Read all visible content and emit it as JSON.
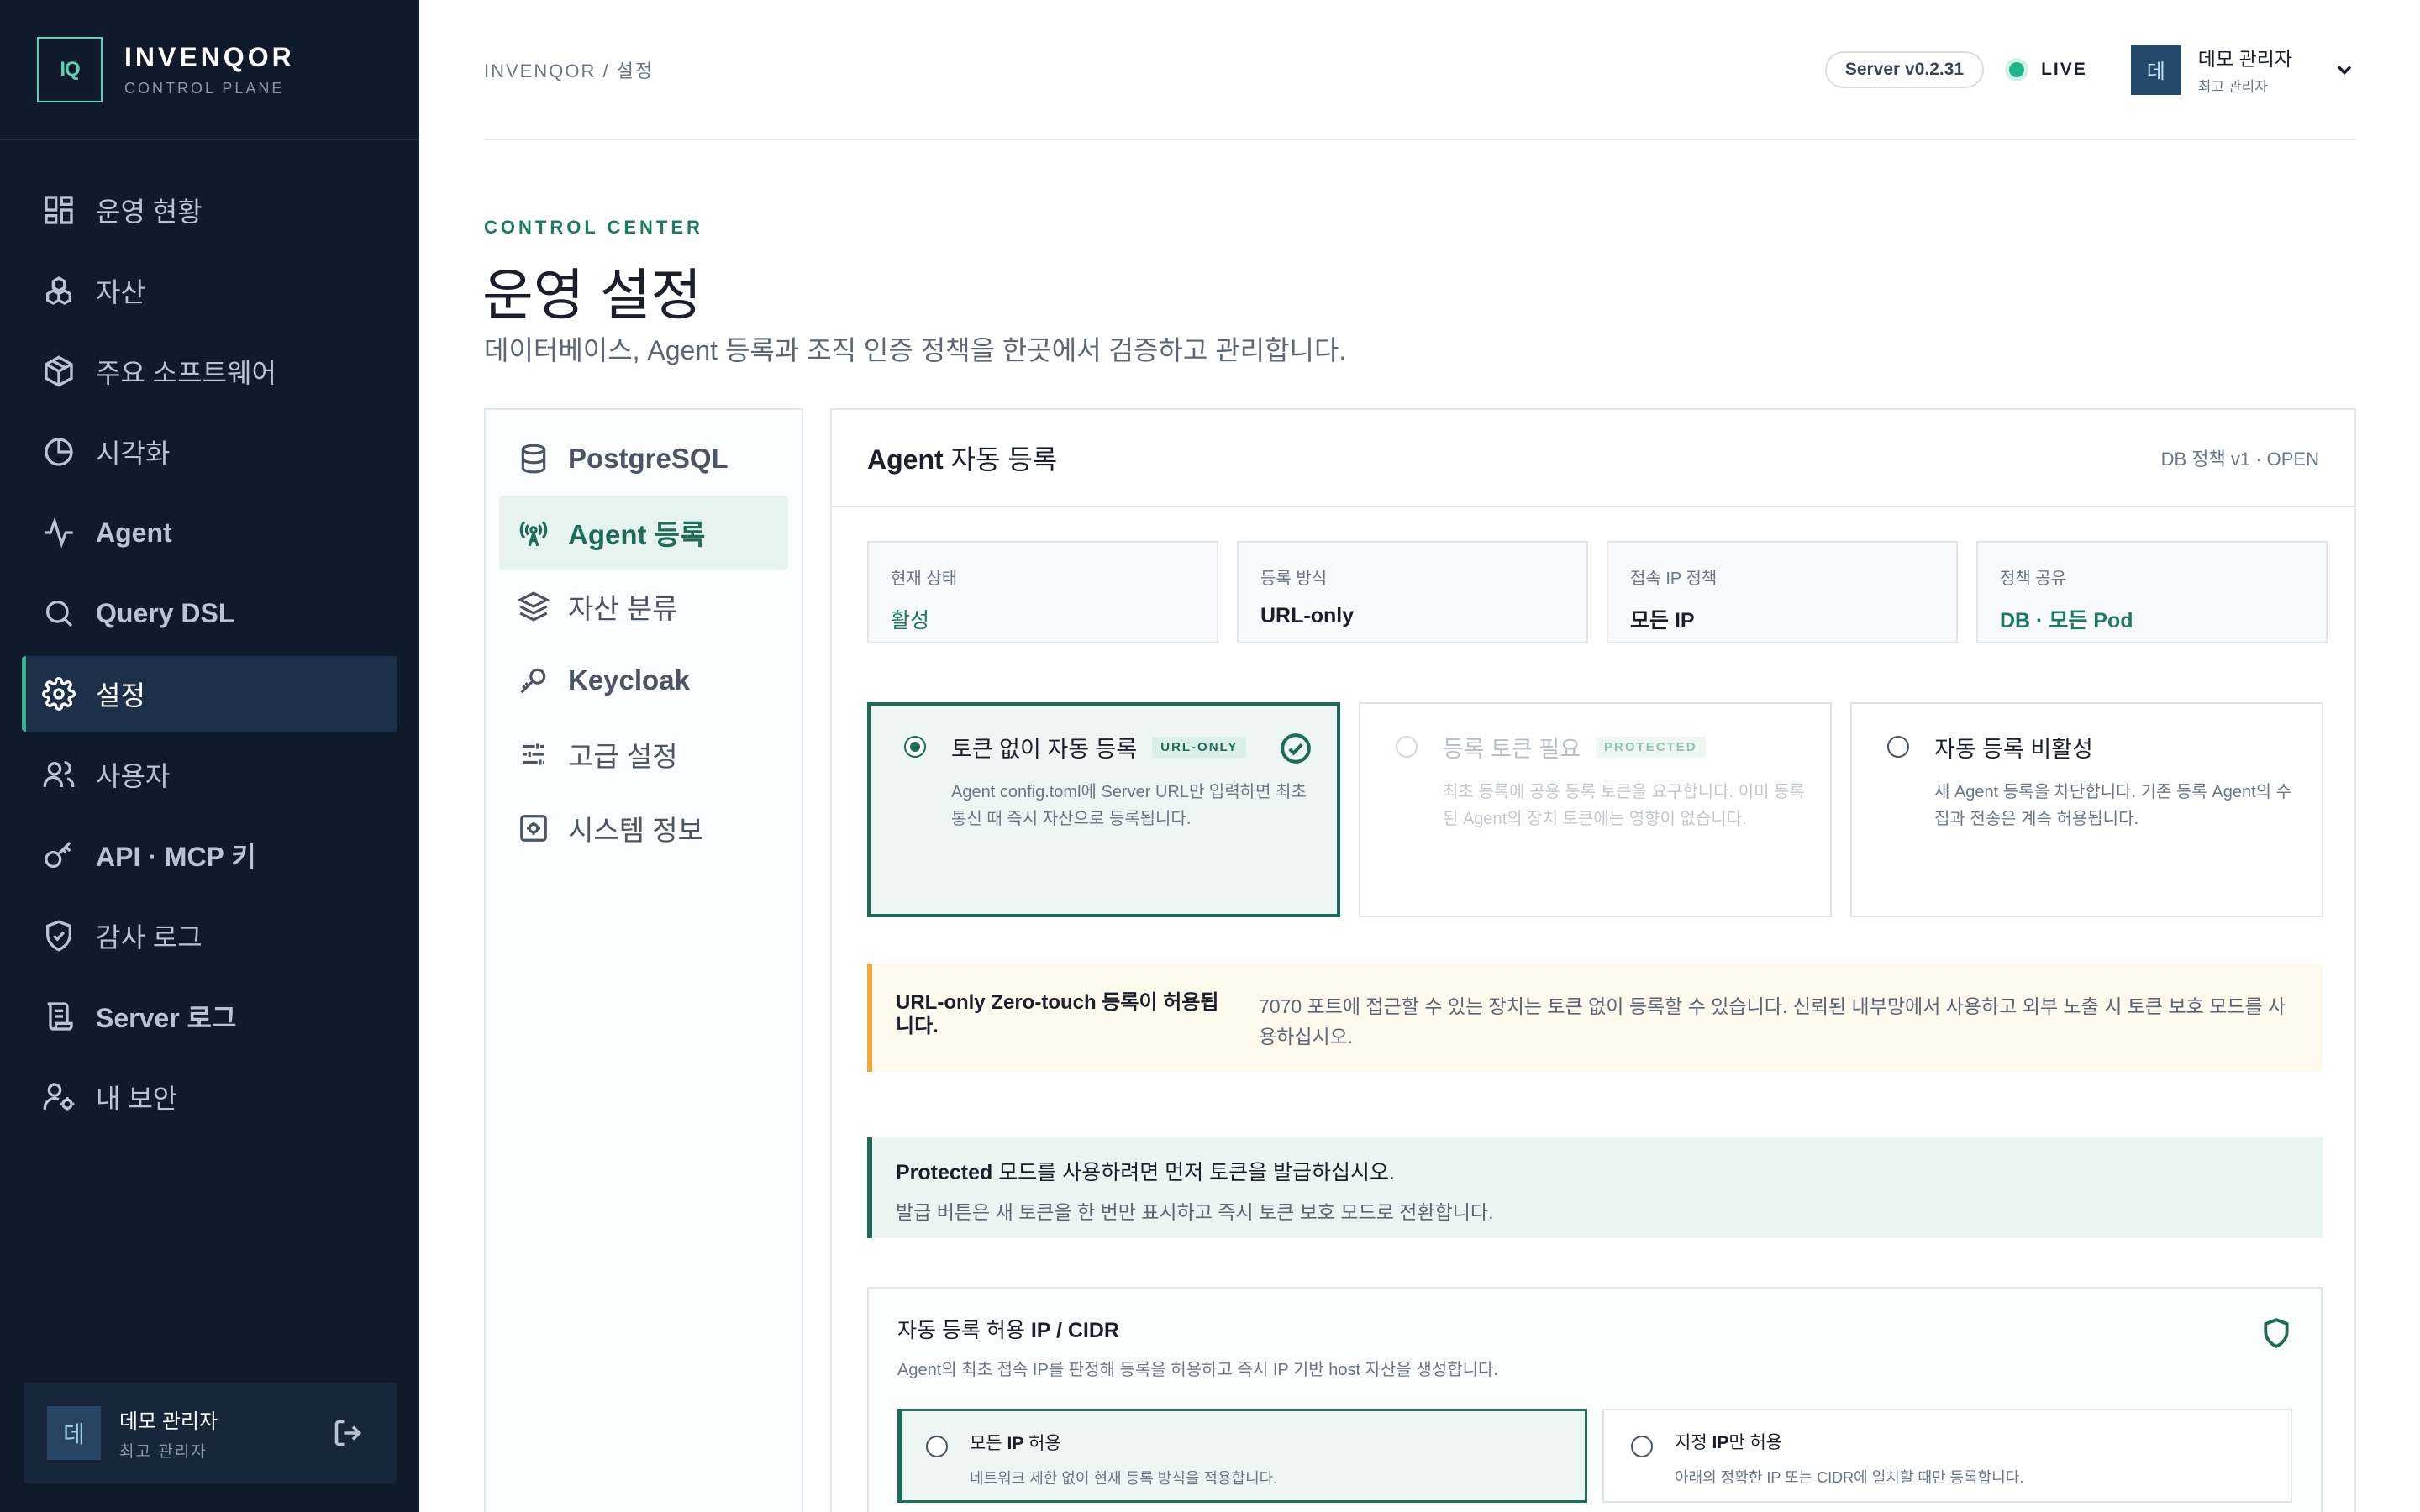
{
  "brand": {
    "logo": "IQ",
    "name": "INVENQOR",
    "sub": "CONTROL PLANE"
  },
  "sidebar": {
    "items": [
      {
        "label": "운영 현황",
        "icon": "dashboard-icon"
      },
      {
        "label": "자산",
        "icon": "assets-icon"
      },
      {
        "label": "주요 소프트웨어",
        "icon": "package-icon"
      },
      {
        "label": "시각화",
        "icon": "pie-chart-icon"
      },
      {
        "label": "Agent",
        "icon": "activity-icon"
      },
      {
        "label": "Query DSL",
        "icon": "search-icon"
      },
      {
        "label": "설정",
        "icon": "gear-icon"
      },
      {
        "label": "사용자",
        "icon": "users-icon"
      },
      {
        "label": "API · MCP 키",
        "icon": "key-icon"
      },
      {
        "label": "감사 로그",
        "icon": "shield-check-icon"
      },
      {
        "label": "Server 로그",
        "icon": "scroll-icon"
      },
      {
        "label": "내 보안",
        "icon": "user-cog-icon"
      }
    ],
    "active_index": 6
  },
  "user": {
    "avatar": "데",
    "name": "데모 관리자",
    "role": "최고 관리자"
  },
  "topbar": {
    "breadcrumb": "INVENQOR / 설정",
    "server_version": "Server v0.2.31",
    "live": "LIVE",
    "user_name": "데모 관리자",
    "user_role": "최고 관리자",
    "avatar": "데"
  },
  "heading": {
    "eyebrow": "CONTROL CENTER",
    "title": "운영 설정",
    "description": "데이터베이스, Agent 등록과 조직 인증 정책을 한곳에서 검증하고 관리합니다."
  },
  "subnav": {
    "items": [
      {
        "label": "PostgreSQL",
        "icon": "database-icon"
      },
      {
        "label": "Agent 등록",
        "icon": "antenna-icon"
      },
      {
        "label": "자산 분류",
        "icon": "layers-icon"
      },
      {
        "label": "Keycloak",
        "icon": "key-icon"
      },
      {
        "label": "고급 설정",
        "icon": "sliders-icon"
      },
      {
        "label": "시스템 정보",
        "icon": "system-icon"
      }
    ],
    "active_index": 1
  },
  "panel": {
    "title_bold": "Agent",
    "title_rest": " 자동 등록",
    "meta": "DB 정책 v1 · OPEN",
    "stats": [
      {
        "label": "현재 상태",
        "value": "활성"
      },
      {
        "label": "등록 방식",
        "value": "URL-only"
      },
      {
        "label": "접속 IP 정책",
        "value": "모든 IP"
      },
      {
        "label": "정책 공유",
        "value": "DB · 모든 Pod"
      }
    ],
    "options": [
      {
        "title": "토큰 없이 자동 등록",
        "tag": "URL-ONLY",
        "desc": "Agent config.toml에 Server URL만 입력하면 최초 통신 때 즉시 자산으로 등록됩니다.",
        "state": "selected"
      },
      {
        "title": "등록 토큰 필요",
        "tag": "PROTECTED",
        "desc": "최초 등록에 공용 등록 토큰을 요구합니다. 이미 등록된 Agent의 장치 토큰에는 영향이 없습니다.",
        "state": "disabled"
      },
      {
        "title": "자동 등록 비활성",
        "tag": "",
        "desc": "새 Agent 등록을 차단합니다. 기존 등록 Agent의 수집과 전송은 계속 허용됩니다.",
        "state": "normal"
      }
    ],
    "warning": {
      "title": "URL-only Zero-touch 등록이 허용됩니다.",
      "text": "7070 포트에 접근할 수 있는 장치는 토큰 없이 등록할 수 있습니다. 신뢰된 내부망에서 사용하고 외부 노출 시 토큰 보호 모드를 사용하십시오."
    },
    "info": {
      "title_bold": "Protected",
      "title_rest": " 모드를 사용하려면 먼저 토큰을 발급하십시오.",
      "text": "발급 버튼은 새 토큰을 한 번만 표시하고 즉시 토큰 보호 모드로 전환합니다."
    },
    "cidr": {
      "title_a": "자동 등록 허용 ",
      "title_b": "IP / CIDR",
      "desc": "Agent의 최초 접속 IP를 판정해 등록을 허용하고 즉시 IP 기반 host 자산을 생성합니다.",
      "options": [
        {
          "title_a": "모든 ",
          "title_b": "IP",
          "title_c": " 허용",
          "desc": "네트워크 제한 없이 현재 등록 방식을 적용합니다."
        },
        {
          "title_a": "지정 ",
          "title_b": "IP",
          "title_c": "만 허용",
          "desc": "아래의 정확한 IP 또는 CIDR에 일치할 때만 등록합니다."
        }
      ]
    }
  },
  "colors": {
    "accent": "#1d6b58",
    "sidebar_bg": "#0f1b2b",
    "live": "#1fb58a",
    "warning": "#f0a83a"
  }
}
